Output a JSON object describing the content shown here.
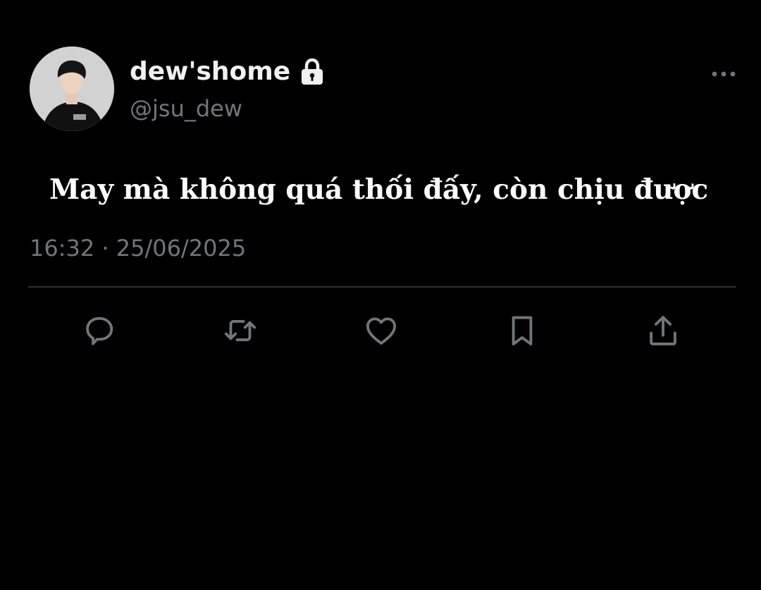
{
  "profile": {
    "display_name": "dew'shome",
    "handle": "@jsu_dew",
    "avatar_icon": "avatar-photo",
    "protected_icon": "lock-icon"
  },
  "tweet": {
    "text": "May mà không quá thối đấy, còn chịu được",
    "timestamp": "16:32 · 25/06/2025"
  },
  "actions": [
    {
      "icon": "reply-icon"
    },
    {
      "icon": "retweet-icon"
    },
    {
      "icon": "like-icon"
    },
    {
      "icon": "bookmark-icon"
    },
    {
      "icon": "share-icon"
    }
  ],
  "more_icon": "more-options-icon",
  "colors": {
    "background": "#000000",
    "text_primary": "#ffffff",
    "text_secondary": "#71767b",
    "divider": "#2f3336",
    "icon": "#71767b"
  }
}
